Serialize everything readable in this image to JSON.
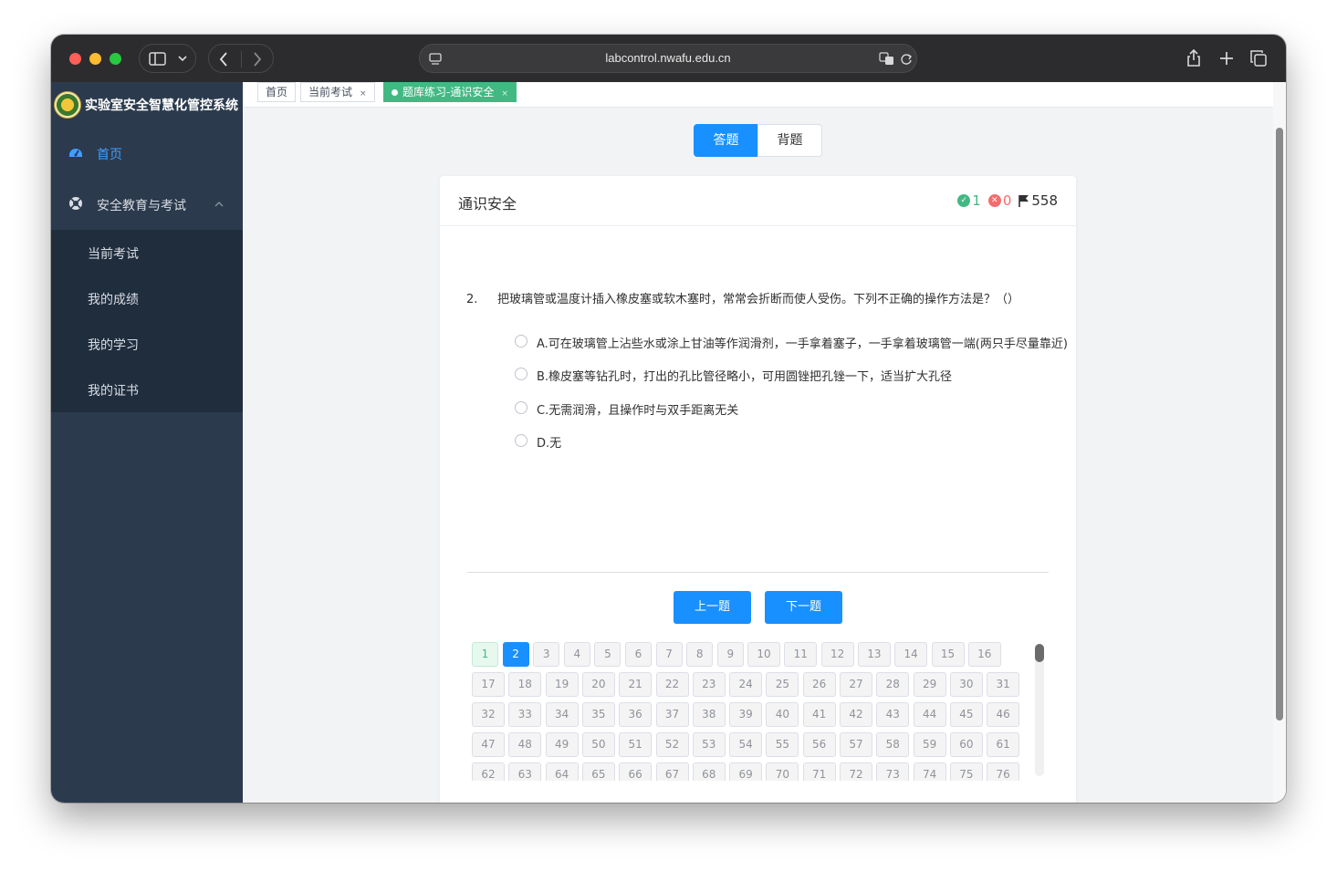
{
  "browser": {
    "url": "labcontrol.nwafu.edu.cn"
  },
  "app": {
    "title": "实验室安全智慧化管控系统"
  },
  "sidebar": {
    "home": "首页",
    "group": "安全教育与考试",
    "sub_items": [
      "当前考试",
      "我的成绩",
      "我的学习",
      "我的证书"
    ],
    "colors": {
      "active": "#409eff",
      "bg": "#2b3a4d",
      "sub_bg": "#1f2d3d"
    }
  },
  "tags": {
    "items": [
      {
        "label": "首页"
      },
      {
        "label": "当前考试",
        "close": "×"
      },
      {
        "label": "题库练习-通识安全",
        "close": "×"
      }
    ]
  },
  "mode": {
    "answer": "答题",
    "recite": "背题"
  },
  "card": {
    "title": "通识安全",
    "correct_count": "1",
    "wrong_count": "0",
    "total_count": "558"
  },
  "question": {
    "number": "2.",
    "text": "把玻璃管或温度计插入橡皮塞或软木塞时，常常会折断而使人受伤。下列不正确的操作方法是？（）",
    "options": [
      "A.可在玻璃管上沾些水或涂上甘油等作润滑剂，一手拿着塞子，一手拿着玻璃管一端(两只手尽量靠近)",
      "B.橡皮塞等钻孔时，打出的孔比管径略小，可用圆锉把孔锉一下，适当扩大孔径",
      "C.无需润滑，且操作时与双手距离无关",
      "D.无"
    ]
  },
  "nav": {
    "prev": "上一题",
    "next": "下一题"
  },
  "question_numbers": {
    "visible": [
      "1",
      "2",
      "3",
      "4",
      "5",
      "6",
      "7",
      "8",
      "9",
      "10",
      "11",
      "12",
      "13",
      "14",
      "15",
      "16",
      "17",
      "18",
      "19",
      "20",
      "21",
      "22",
      "23",
      "24",
      "25",
      "26",
      "27",
      "28",
      "29",
      "30",
      "31",
      "32",
      "33",
      "34",
      "35",
      "36",
      "37",
      "38",
      "39",
      "40",
      "41",
      "42",
      "43",
      "44",
      "45",
      "46",
      "47",
      "48",
      "49",
      "50",
      "51",
      "52",
      "53",
      "54",
      "55",
      "56",
      "57",
      "58",
      "59",
      "60",
      "61",
      "62",
      "63",
      "64",
      "65",
      "66",
      "67",
      "68",
      "69",
      "70",
      "71",
      "72",
      "73",
      "74",
      "75",
      "76"
    ],
    "correct": [
      "1"
    ],
    "current": "2"
  }
}
